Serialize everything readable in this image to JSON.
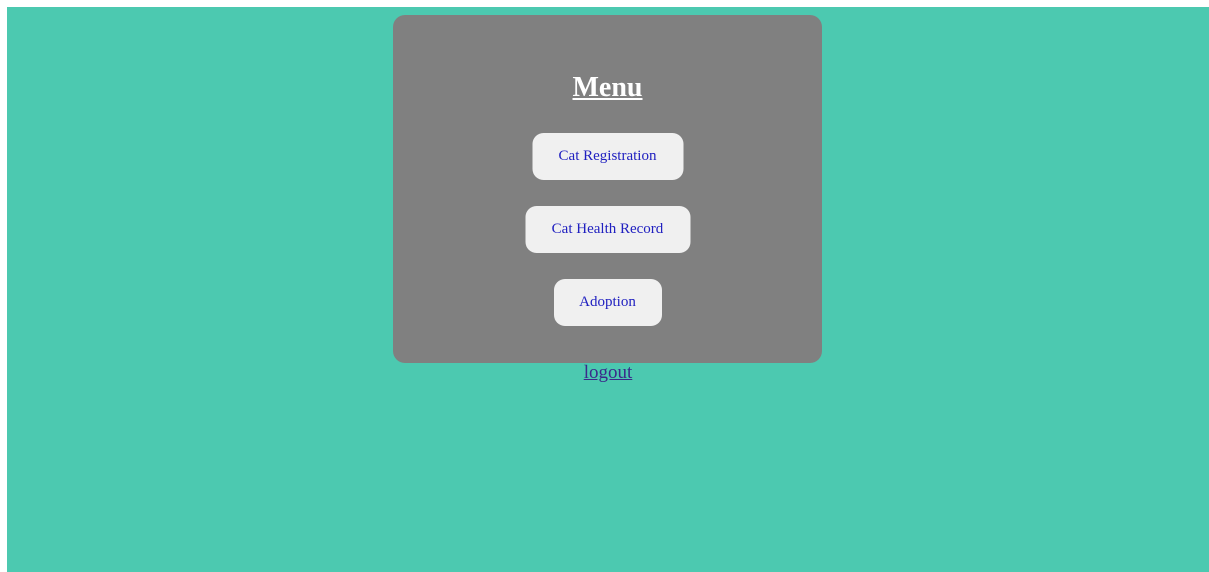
{
  "menu": {
    "title": "Menu",
    "buttons": [
      {
        "label": "Cat Registration"
      },
      {
        "label": "Cat Health Record"
      },
      {
        "label": "Adoption"
      }
    ]
  },
  "logout": {
    "label": "logout"
  },
  "colors": {
    "background": "#4cc9b0",
    "card": "#808080",
    "button_bg": "#f0f0f0",
    "button_text": "#2020c0",
    "title_text": "#ffffff",
    "link": "#3b2a8a"
  }
}
